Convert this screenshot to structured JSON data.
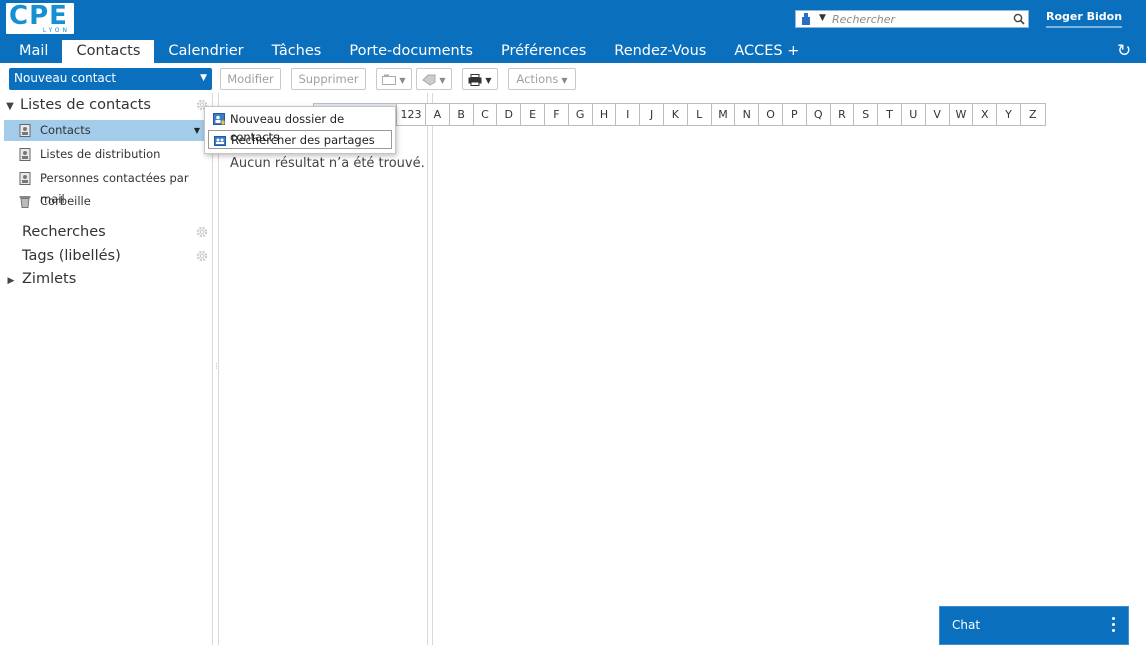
{
  "header": {
    "logo_text": "CPE",
    "logo_sub": "LYON",
    "search_placeholder": "Rechercher",
    "user_name": "Roger Bidon",
    "tabs": [
      {
        "label": "Mail",
        "active": false
      },
      {
        "label": "Contacts",
        "active": true
      },
      {
        "label": "Calendrier",
        "active": false
      },
      {
        "label": "Tâches",
        "active": false
      },
      {
        "label": "Porte-documents",
        "active": false
      },
      {
        "label": "Préférences",
        "active": false
      },
      {
        "label": "Rendez-Vous",
        "active": false
      },
      {
        "label": "ACCES +",
        "active": false
      }
    ],
    "refresh_icon": "refresh-icon"
  },
  "toolbar": {
    "new_contact": "Nouveau contact",
    "modify": "Modifier",
    "delete": "Supprimer",
    "actions": "Actions"
  },
  "sidebar": {
    "contact_lists": "Listes de contacts",
    "items": [
      {
        "label": "Contacts",
        "selected": true
      },
      {
        "label": "Listes de distribution",
        "selected": false
      },
      {
        "label": "Personnes contactées par mail",
        "selected": false
      },
      {
        "label": "Corbeille",
        "selected": false
      }
    ],
    "searches": "Recherches",
    "tags": "Tags (libellés)",
    "zimlets": "Zimlets"
  },
  "alphabet": [
    "123",
    "A",
    "B",
    "C",
    "D",
    "E",
    "F",
    "G",
    "H",
    "I",
    "J",
    "K",
    "L",
    "M",
    "N",
    "O",
    "P",
    "Q",
    "R",
    "S",
    "T",
    "U",
    "V",
    "W",
    "X",
    "Y",
    "Z"
  ],
  "list": {
    "empty_message": "Aucun résultat n’a été trouvé."
  },
  "context_menu": {
    "items": [
      {
        "label": "Nouveau dossier de contacts",
        "icon": "new-folder-icon"
      },
      {
        "label": "Rechercher des partages",
        "icon": "find-shares-icon"
      }
    ]
  },
  "chat": {
    "label": "Chat"
  },
  "colors": {
    "brand_blue": "#0a6fbc",
    "selected_row": "#a3cbea"
  }
}
